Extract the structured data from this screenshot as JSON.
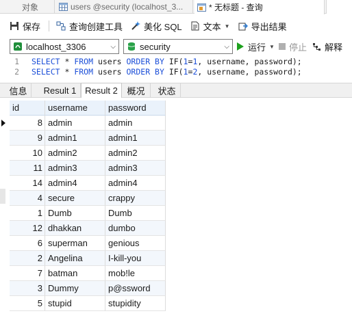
{
  "tabs": {
    "objects": "对象",
    "users_tab": "users @security (localhost_3...",
    "query_tab": "* 无标题 - 查询"
  },
  "toolbar": {
    "save": "保存",
    "query_builder": "查询创建工具",
    "beautify": "美化 SQL",
    "text": "文本",
    "export": "导出结果"
  },
  "connection": {
    "server": "localhost_3306",
    "database": "security",
    "run": "运行",
    "stop": "停止",
    "explain": "解释"
  },
  "editor": {
    "lines": [
      {
        "no": "1",
        "select": "SELECT",
        "star": " * ",
        "from": "FROM",
        "t1": " users ",
        "order": "ORDER BY",
        "if": " IF(",
        "n1": "1",
        "eq": "=",
        "n2": "1",
        "rest": ", username, password);"
      },
      {
        "no": "2",
        "select": "SELECT",
        "star": " * ",
        "from": "FROM",
        "t1": " users ",
        "order": "ORDER BY",
        "if": " IF(",
        "n1": "1",
        "eq": "=",
        "n2": "2",
        "rest": ", username, password);"
      }
    ]
  },
  "result_tabs": [
    "信息",
    "Result 1",
    "Result 2",
    "概况",
    "状态"
  ],
  "grid": {
    "columns": [
      "id",
      "username",
      "password"
    ],
    "rows": [
      {
        "id": "8",
        "username": "admin",
        "password": "admin"
      },
      {
        "id": "9",
        "username": "admin1",
        "password": "admin1"
      },
      {
        "id": "10",
        "username": "admin2",
        "password": "admin2"
      },
      {
        "id": "11",
        "username": "admin3",
        "password": "admin3"
      },
      {
        "id": "14",
        "username": "admin4",
        "password": "admin4"
      },
      {
        "id": "4",
        "username": "secure",
        "password": "crappy"
      },
      {
        "id": "1",
        "username": "Dumb",
        "password": "Dumb"
      },
      {
        "id": "12",
        "username": "dhakkan",
        "password": "dumbo"
      },
      {
        "id": "6",
        "username": "superman",
        "password": "genious"
      },
      {
        "id": "2",
        "username": "Angelina",
        "password": "I-kill-you"
      },
      {
        "id": "7",
        "username": "batman",
        "password": "mob!le"
      },
      {
        "id": "3",
        "username": "Dummy",
        "password": "p@ssword"
      },
      {
        "id": "5",
        "username": "stupid",
        "password": "stupidity"
      }
    ]
  },
  "colors": {
    "keyword": "#1c4fd8",
    "header_bg": "#eaf2fb",
    "alt_row_bg": "#f3f7fc",
    "run_green": "#1ea11e"
  }
}
